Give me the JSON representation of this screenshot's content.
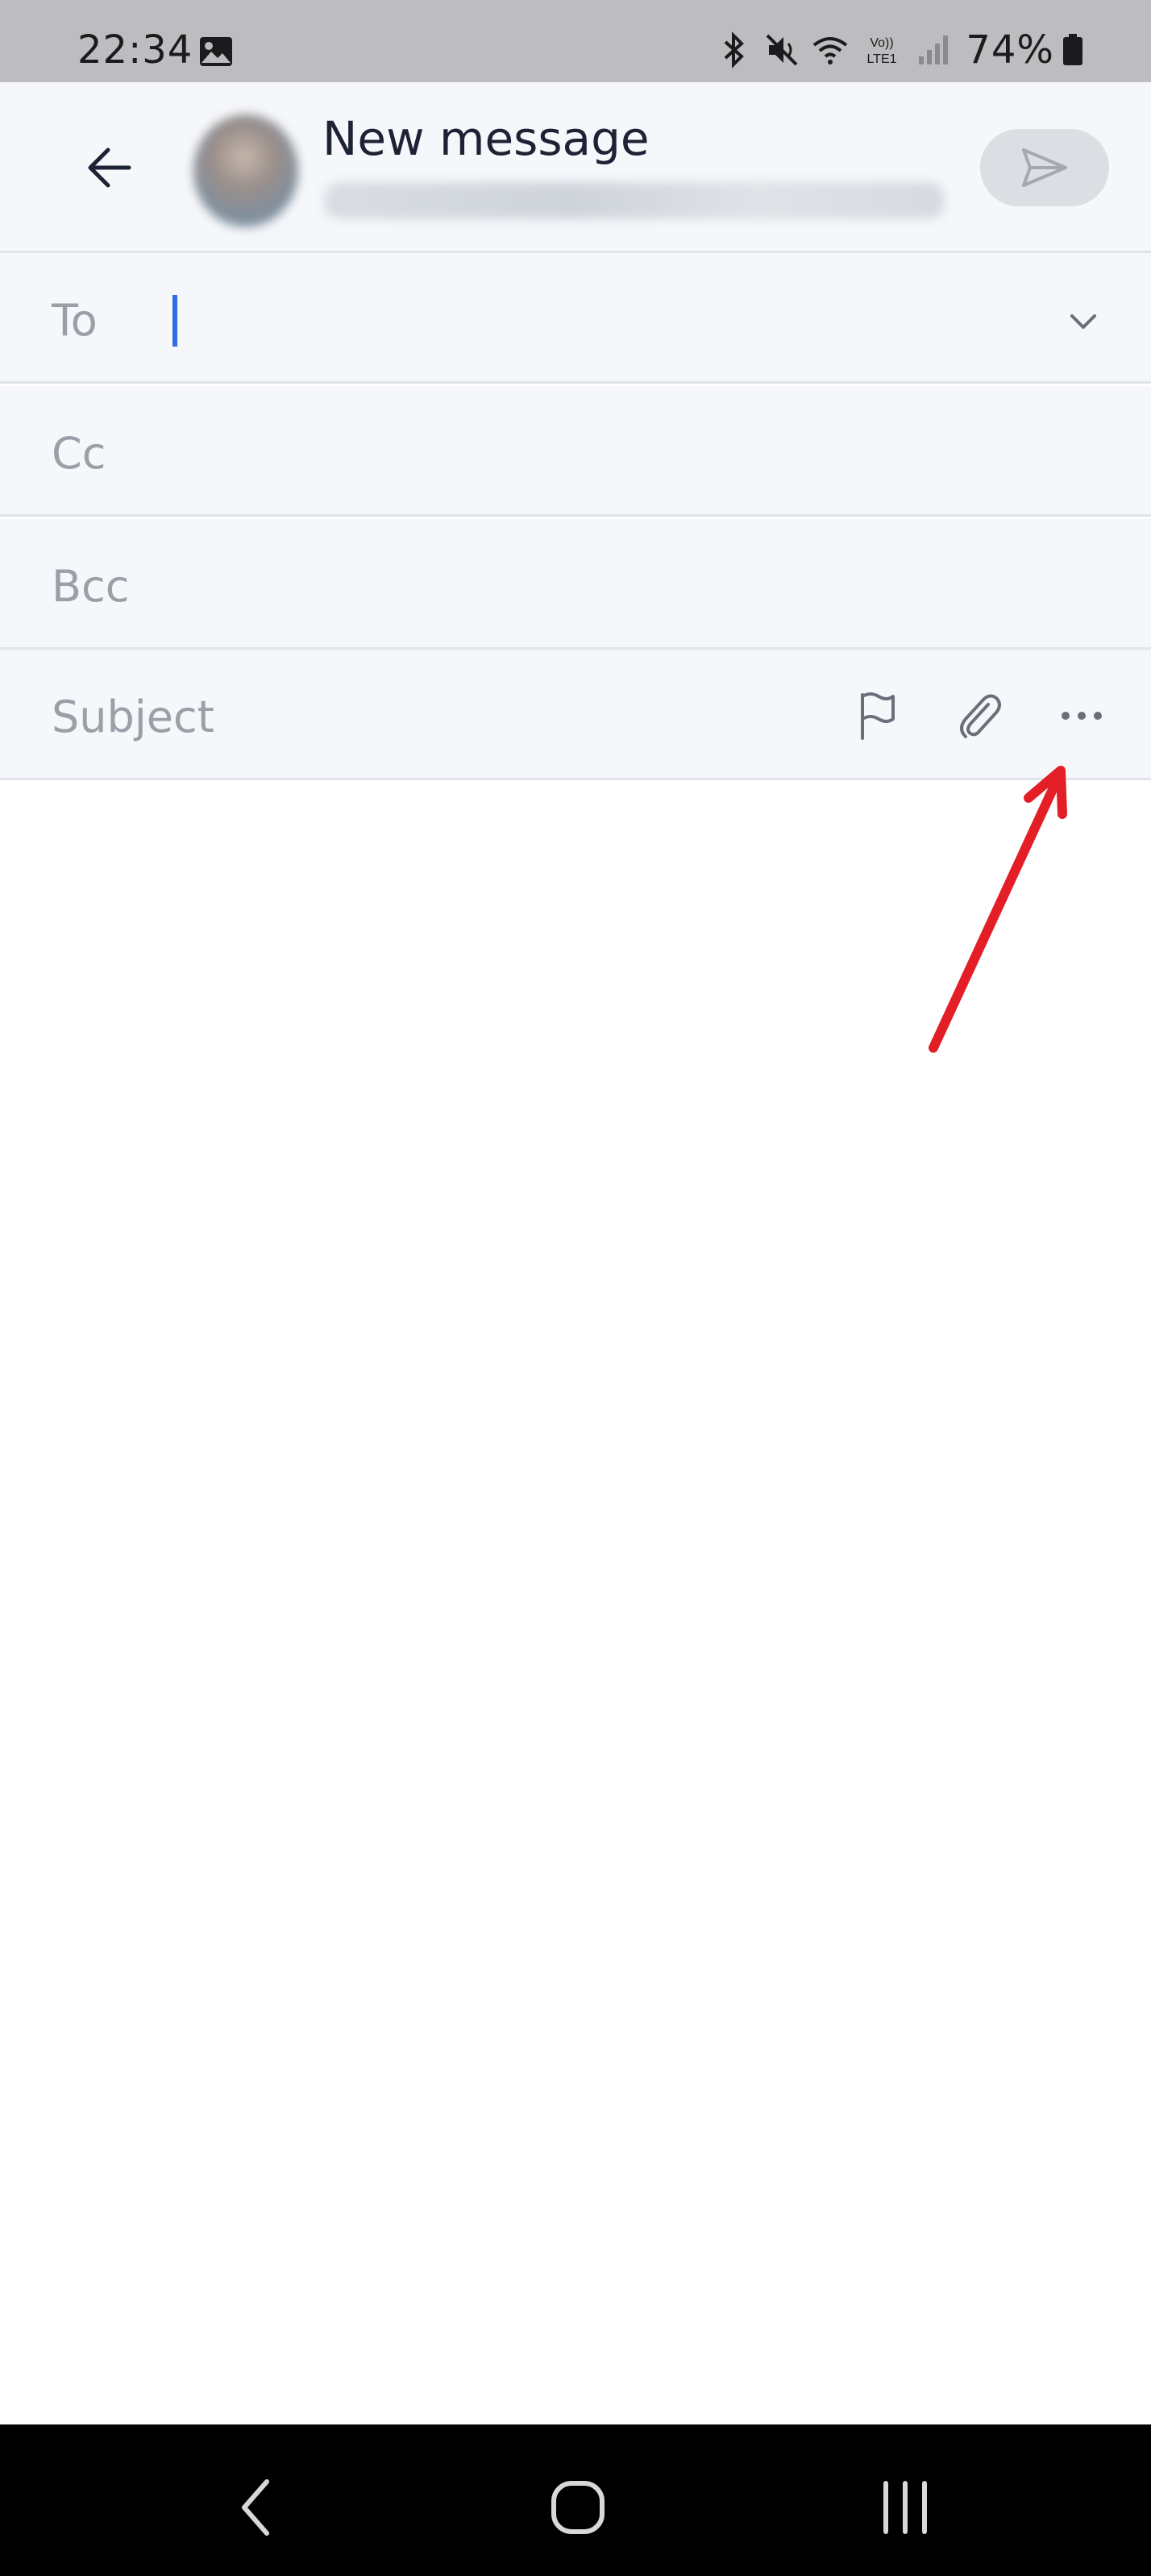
{
  "status_bar": {
    "time": "22:34",
    "battery": "74%",
    "icons": [
      "gallery-icon",
      "bluetooth-icon",
      "mute-icon",
      "wifi-icon",
      "volte-icon",
      "signal-icon",
      "battery-icon"
    ],
    "volte_text_top": "Vo))",
    "volte_text_bottom": "LTE1"
  },
  "header": {
    "title": "New message",
    "back_icon": "arrow-left-icon",
    "send_icon": "send-icon"
  },
  "fields": {
    "to_label": "To",
    "to_value": "",
    "cc_label": "Cc",
    "bcc_label": "Bcc",
    "subject_label": "Subject"
  },
  "toolbar_icons": [
    "flag-icon",
    "paperclip-icon",
    "more-icon"
  ],
  "colors": {
    "cursor": "#2f6de1",
    "annotation_arrow": "#e41e26",
    "header_bg": "#f5f7fa",
    "send_button_bg": "#dcdee3"
  },
  "nav_bar": {
    "icons": [
      "back-nav-icon",
      "home-nav-icon",
      "recents-nav-icon"
    ]
  }
}
